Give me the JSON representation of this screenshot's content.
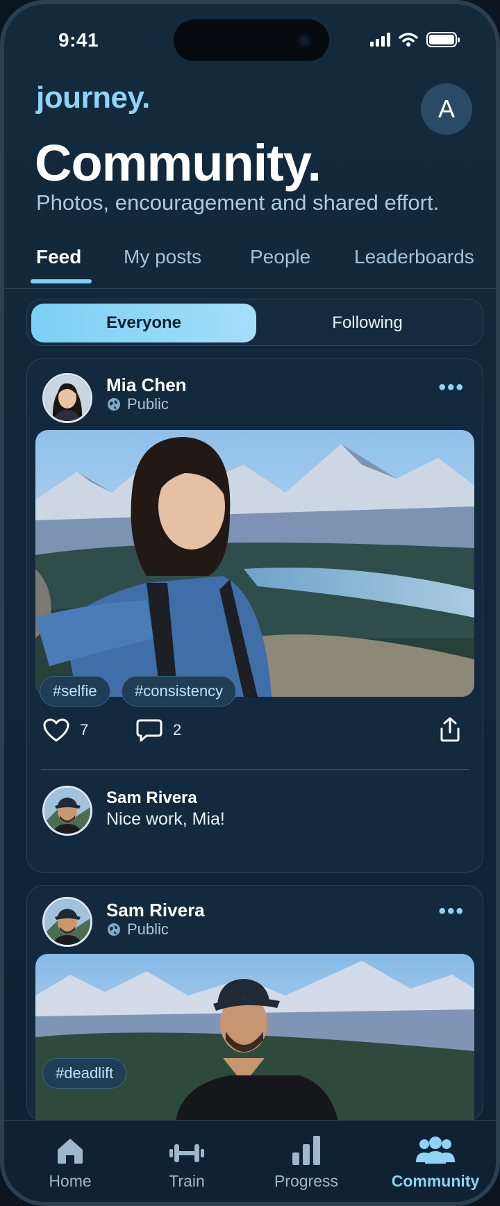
{
  "status_bar": {
    "time": "9:41"
  },
  "header": {
    "brand": "journey.",
    "avatar_initial": "A",
    "title": "Community.",
    "subtitle": "Photos, encouragement and shared effort."
  },
  "tabs": [
    {
      "label": "Feed",
      "active": true
    },
    {
      "label": "My posts",
      "active": false
    },
    {
      "label": "People",
      "active": false
    },
    {
      "label": "Leaderboards",
      "active": false
    }
  ],
  "filter": {
    "options": [
      "Everyone",
      "Following"
    ],
    "selected": "Everyone"
  },
  "posts": [
    {
      "author": "Mia Chen",
      "visibility": "Public",
      "tags": [
        "#selfie",
        "#consistency"
      ],
      "likes": "7",
      "comments": "2",
      "comment": {
        "author": "Sam Rivera",
        "text": "Nice work, Mia!"
      }
    },
    {
      "author": "Sam Rivera",
      "visibility": "Public",
      "tags": [
        "#deadlift"
      ]
    }
  ],
  "bottom_nav": [
    {
      "label": "Home",
      "icon": "home-icon",
      "active": false
    },
    {
      "label": "Train",
      "icon": "dumbbell-icon",
      "active": false
    },
    {
      "label": "Progress",
      "icon": "bar-chart-icon",
      "active": false
    },
    {
      "label": "Community",
      "icon": "people-icon",
      "active": true
    }
  ],
  "colors": {
    "accent": "#8fd3f5",
    "background": "#10263a",
    "card": "#132a3e"
  }
}
